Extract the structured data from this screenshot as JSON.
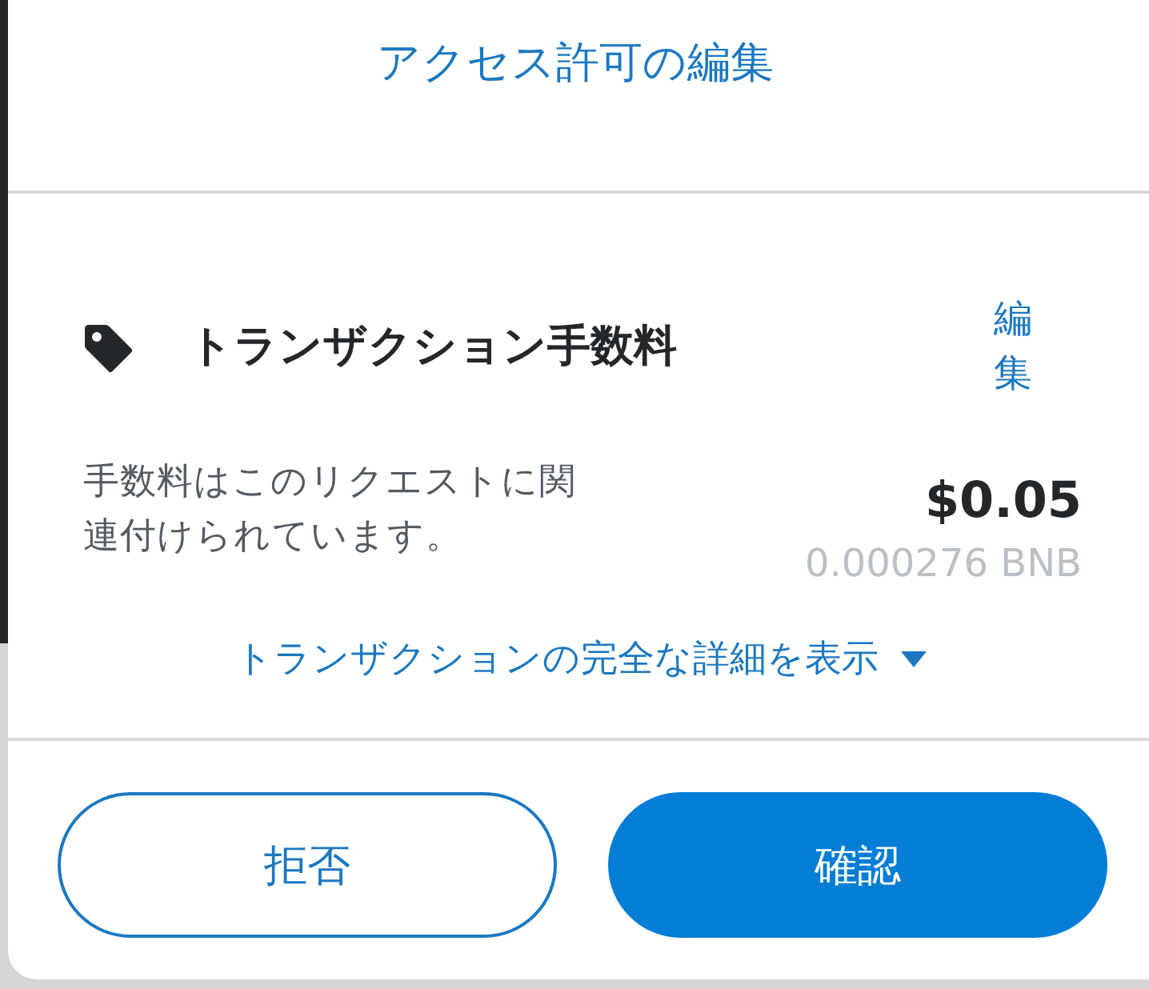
{
  "header": {
    "title": "アクセス許可の編集"
  },
  "fee": {
    "title": "トランザクション手数料",
    "edit_label": "編集",
    "description": "手数料はこのリクエストに関連付けられています。",
    "fiat_amount": "$0.05",
    "crypto_amount": "0.000276 BNB",
    "details_link": "トランザクションの完全な詳細を表示",
    "details_expanded": false
  },
  "buttons": [
    {
      "label": "拒否",
      "kind": "secondary"
    },
    {
      "label": "確認",
      "kind": "primary"
    }
  ]
}
